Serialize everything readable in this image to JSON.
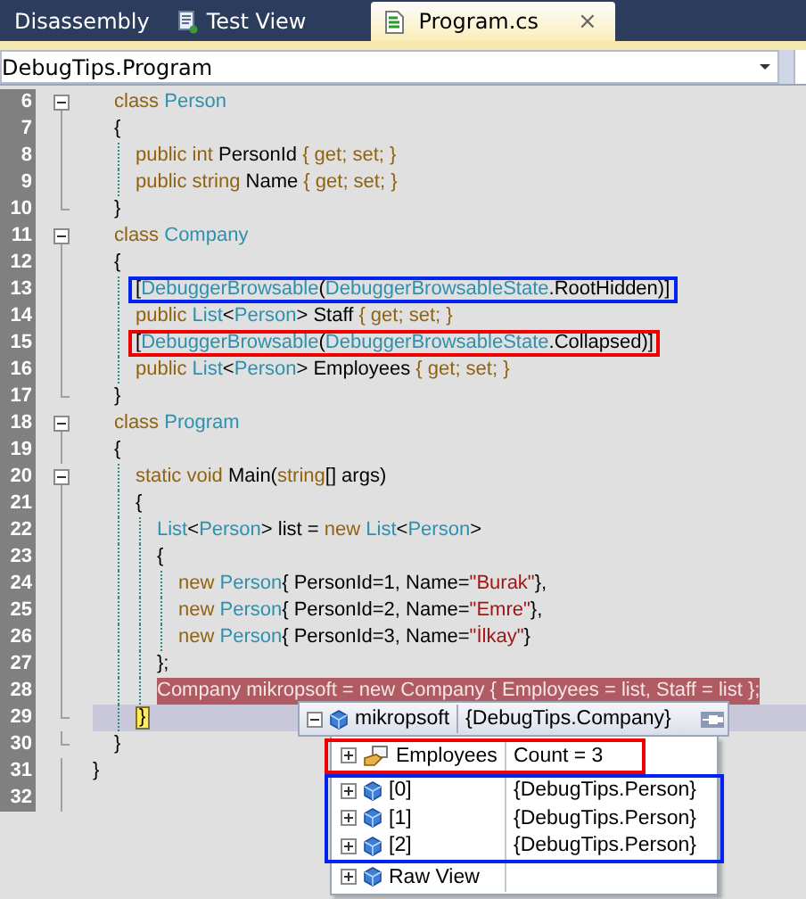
{
  "tabs": [
    {
      "label": "Disassembly",
      "selected": false
    },
    {
      "label": "Test View",
      "selected": false
    },
    {
      "label": "Program.cs",
      "selected": true,
      "close_glyph": "×"
    }
  ],
  "navigation": {
    "type_dropdown": "DebugTips.Program"
  },
  "editor": {
    "lines": [
      {
        "kind": "line",
        "number": "6",
        "collapsible": true,
        "tokens": [
          {
            "kind": "kw",
            "text": "class "
          },
          {
            "kind": "type",
            "text": "Person"
          }
        ],
        "children": [
          {
            "kind": "brace",
            "number": "7",
            "tokens": [
              {
                "kind": "plain",
                "text": "{"
              }
            ]
          },
          {
            "kind": "line",
            "number": "8",
            "tokens": [
              {
                "kind": "kw",
                "text": "public int "
              },
              {
                "kind": "plain",
                "text": "PersonId "
              },
              {
                "kind": "kw",
                "text": "{ get; set; }"
              }
            ]
          },
          {
            "kind": "line",
            "number": "9",
            "tokens": [
              {
                "kind": "kw",
                "text": "public string "
              },
              {
                "kind": "plain",
                "text": "Name "
              },
              {
                "kind": "kw",
                "text": "{ get; set; }"
              }
            ]
          },
          {
            "kind": "brace",
            "number": "10",
            "tokens": [
              {
                "kind": "plain",
                "text": "}"
              }
            ]
          }
        ]
      },
      {
        "kind": "line",
        "number": "11",
        "collapsible": true,
        "tokens": [
          {
            "kind": "kw",
            "text": "class "
          },
          {
            "kind": "type",
            "text": "Company"
          }
        ],
        "children": [
          {
            "kind": "brace",
            "number": "12",
            "tokens": [
              {
                "kind": "plain",
                "text": "{"
              }
            ]
          },
          {
            "kind": "line",
            "number": "13",
            "color": "#0022ee",
            "tokens": [
              {
                "kind": "plain",
                "text": "["
              },
              {
                "kind": "type",
                "text": "DebuggerBrowsable"
              },
              {
                "kind": "plain",
                "text": "("
              },
              {
                "kind": "type",
                "text": "DebuggerBrowsableState"
              },
              {
                "kind": "plain",
                "text": ".RootHidden)]"
              }
            ]
          },
          {
            "kind": "line",
            "number": "14",
            "tokens": [
              {
                "kind": "kw",
                "text": "public "
              },
              {
                "kind": "type",
                "text": "List"
              },
              {
                "kind": "plain",
                "text": "<"
              },
              {
                "kind": "type",
                "text": "Person"
              },
              {
                "kind": "plain",
                "text": "> Staff "
              },
              {
                "kind": "kw",
                "text": "{ get; set; }"
              }
            ]
          },
          {
            "kind": "line",
            "number": "15",
            "color": "#ee0000",
            "tokens": [
              {
                "kind": "plain",
                "text": "["
              },
              {
                "kind": "type",
                "text": "DebuggerBrowsable"
              },
              {
                "kind": "plain",
                "text": "("
              },
              {
                "kind": "type",
                "text": "DebuggerBrowsableState"
              },
              {
                "kind": "plain",
                "text": ".Collapsed)]"
              }
            ]
          },
          {
            "kind": "line",
            "number": "16",
            "tokens": [
              {
                "kind": "kw",
                "text": "public "
              },
              {
                "kind": "type",
                "text": "List"
              },
              {
                "kind": "plain",
                "text": "<"
              },
              {
                "kind": "type",
                "text": "Person"
              },
              {
                "kind": "plain",
                "text": "> Employees "
              },
              {
                "kind": "kw",
                "text": "{ get; set; }"
              }
            ]
          },
          {
            "kind": "brace",
            "number": "17",
            "tokens": [
              {
                "kind": "plain",
                "text": "}"
              }
            ]
          }
        ]
      },
      {
        "kind": "line",
        "number": "18",
        "collapsible": true,
        "tokens": [
          {
            "kind": "kw",
            "text": "class "
          },
          {
            "kind": "type",
            "text": "Program"
          }
        ],
        "children": [
          {
            "kind": "brace",
            "number": "19",
            "tokens": [
              {
                "kind": "plain",
                "text": "{"
              }
            ]
          },
          {
            "kind": "line",
            "number": "20",
            "collapsible": true,
            "tokens": [
              {
                "kind": "kw",
                "text": "static void "
              },
              {
                "kind": "plain",
                "text": "Main("
              },
              {
                "kind": "kw",
                "text": "string"
              },
              {
                "kind": "plain",
                "text": "[] args)"
              }
            ],
            "children": [
              {
                "kind": "brace",
                "number": "21",
                "tokens": [
                  {
                    "kind": "plain",
                    "text": "{"
                  }
                ]
              },
              {
                "kind": "line",
                "number": "22",
                "tokens": [
                  {
                    "kind": "type",
                    "text": "List"
                  },
                  {
                    "kind": "plain",
                    "text": "<"
                  },
                  {
                    "kind": "type",
                    "text": "Person"
                  },
                  {
                    "kind": "plain",
                    "text": "> list = "
                  },
                  {
                    "kind": "kw",
                    "text": "new "
                  },
                  {
                    "kind": "type",
                    "text": "List"
                  },
                  {
                    "kind": "plain",
                    "text": "<"
                  },
                  {
                    "kind": "type",
                    "text": "Person"
                  },
                  {
                    "kind": "plain",
                    "text": ">"
                  }
                ],
                "children": [
                  {
                    "kind": "brace",
                    "number": "23",
                    "tokens": [
                      {
                        "kind": "plain",
                        "text": "{"
                      }
                    ]
                  },
                  {
                    "kind": "line",
                    "number": "24",
                    "tokens": [
                      {
                        "kind": "kw",
                        "text": "new "
                      },
                      {
                        "kind": "type",
                        "text": "Person"
                      },
                      {
                        "kind": "plain",
                        "text": "{ PersonId=1, Name="
                      },
                      {
                        "kind": "str",
                        "text": "\"Burak\""
                      },
                      {
                        "kind": "plain",
                        "text": "},"
                      }
                    ]
                  },
                  {
                    "kind": "line",
                    "number": "25",
                    "tokens": [
                      {
                        "kind": "kw",
                        "text": "new "
                      },
                      {
                        "kind": "type",
                        "text": "Person"
                      },
                      {
                        "kind": "plain",
                        "text": "{ PersonId=2, Name="
                      },
                      {
                        "kind": "str",
                        "text": "\"Emre\""
                      },
                      {
                        "kind": "plain",
                        "text": "},"
                      }
                    ]
                  },
                  {
                    "kind": "line",
                    "number": "26",
                    "tokens": [
                      {
                        "kind": "kw",
                        "text": "new "
                      },
                      {
                        "kind": "type",
                        "text": "Person"
                      },
                      {
                        "kind": "plain",
                        "text": "{ PersonId=3, Name="
                      },
                      {
                        "kind": "str",
                        "text": "\"İlkay\""
                      },
                      {
                        "kind": "plain",
                        "text": "}"
                      }
                    ]
                  },
                  {
                    "kind": "brace",
                    "number": "27",
                    "tokens": [
                      {
                        "kind": "plain",
                        "text": "};"
                      }
                    ]
                  }
                ]
              },
              {
                "kind": "line",
                "number": "28",
                "selected": true,
                "tokens": [
                  {
                    "kind": "plain",
                    "text": "Company mikropsoft = new Company { Employees = list, Staff = list };"
                  }
                ]
              },
              {
                "kind": "brace",
                "number": "29",
                "current_statement": true,
                "tokens": [
                  {
                    "kind": "current",
                    "text": "}"
                  }
                ]
              }
            ]
          },
          {
            "kind": "brace",
            "number": "30",
            "tokens": [
              {
                "kind": "plain",
                "text": "}"
              }
            ]
          }
        ]
      },
      {
        "kind": "brace",
        "number": "31",
        "tokens": [
          {
            "kind": "plain",
            "text": "}"
          }
        ]
      },
      {
        "kind": "line",
        "number": "32"
      }
    ]
  },
  "datatip": {
    "name": "mikropsoft",
    "value": "{DebugTips.Company}",
    "expanded": true,
    "rows": [
      {
        "kind": "property",
        "name": "Employees",
        "value": "Count = 3",
        "color": "#ee0000"
      },
      {
        "kind": "object",
        "name": "[0]",
        "value": "{DebugTips.Person}",
        "color": "#0022ee"
      },
      {
        "kind": "object",
        "name": "[1]",
        "value": "{DebugTips.Person}",
        "color": "#0022ee"
      },
      {
        "kind": "object",
        "name": "[2]",
        "value": "{DebugTips.Person}",
        "color": "#0022ee"
      },
      {
        "kind": "object",
        "name": "Raw View"
      }
    ]
  }
}
